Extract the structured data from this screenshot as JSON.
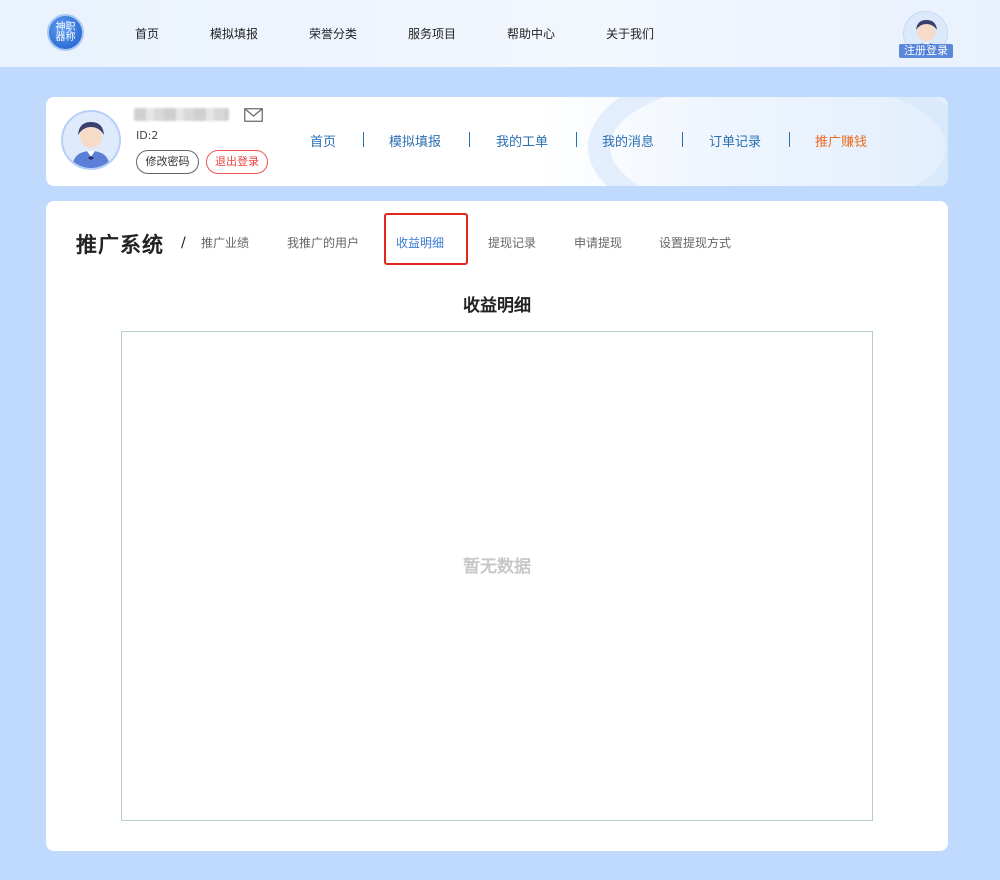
{
  "logo": {
    "text": "神职器称",
    "icon": "logo-badge-icon"
  },
  "top_nav": {
    "items": [
      "首页",
      "模拟填报",
      "荣誉分类",
      "服务项目",
      "帮助中心",
      "关于我们"
    ],
    "login_label": "注册登录"
  },
  "profile": {
    "id_text": "ID:2",
    "change_password_label": "修改密码",
    "logout_label": "退出登录",
    "mail_icon": "mail-icon"
  },
  "sub_nav": {
    "items": [
      "首页",
      "模拟填报",
      "我的工单",
      "我的消息",
      "订单记录",
      "推广赚钱"
    ],
    "active_index": 5,
    "active_color": "#ee6a1e",
    "link_color": "#2a6fb0"
  },
  "main": {
    "section_title": "推广系统",
    "separator": "/",
    "tabs": [
      "推广业绩",
      "我推广的用户",
      "收益明细",
      "提现记录",
      "申请提现",
      "设置提现方式"
    ],
    "active_tab_index": 2,
    "active_tab_color": "#3a7ad6",
    "highlight_color": "#e3261b",
    "detail_heading": "收益明细",
    "empty_text": "暂无数据"
  },
  "colors": {
    "page_background": "#bfdafd",
    "panel_background": "#ffffff"
  }
}
